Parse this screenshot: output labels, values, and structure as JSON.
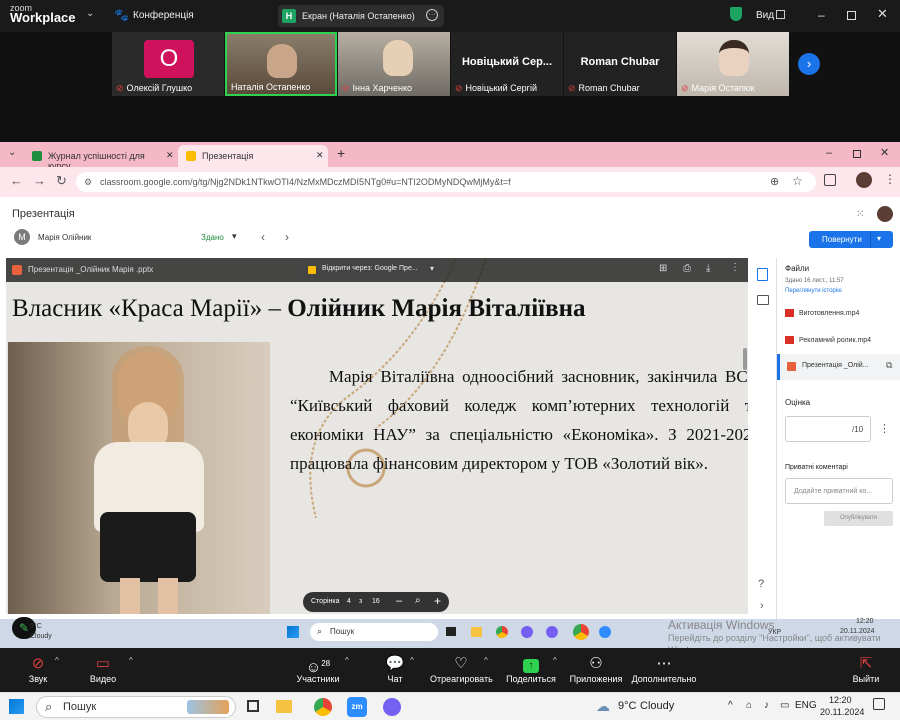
{
  "zoom": {
    "logo_line1": "zoom",
    "logo_line2": "Workplace",
    "conference_label": "Конференція",
    "screen_share_label": "Екран (Наталія Остапенко)",
    "screen_share_badge": "H",
    "view_label": "Вид",
    "participants": [
      {
        "name": "Олексій Глушко",
        "initial": "О",
        "type": "avatar",
        "color": "#d0115c"
      },
      {
        "name": "Наталія Остапенко",
        "type": "video"
      },
      {
        "name": "Інна Харченко",
        "type": "video"
      },
      {
        "name": "Новіцький Сергій",
        "display": "Новіцький Сер...",
        "type": "name"
      },
      {
        "name": "Roman Chubar",
        "display": "Roman Chubar",
        "type": "name"
      },
      {
        "name": "Марія Остапюк",
        "type": "video"
      }
    ],
    "bottom": {
      "audio": "Звук",
      "video": "Видео",
      "participants": "Участники",
      "participants_count": "28",
      "chat": "Чат",
      "react": "Отреагировать",
      "share": "Поделиться",
      "apps": "Приложения",
      "more": "Дополнительно",
      "leave": "Выйти"
    }
  },
  "browser": {
    "tabs": [
      {
        "title": "Журнал успішності для курсу"
      },
      {
        "title": "Презентація"
      }
    ],
    "url": "classroom.google.com/g/tg/Njg2NDk1NTkwOTI4/NzMxMDczMDI5NTg0#u=NTI2ODMyNDQwMjMy&t=f"
  },
  "classroom": {
    "title": "Презентація",
    "student_initial": "М",
    "student_name": "Марія Олійник",
    "status": "Здано",
    "return_button": "Повернути",
    "viewer": {
      "file_name": "Презентація _Олійник Марія .pptx",
      "open_with": "Відкрити через: Google Пре...",
      "page_label": "Сторінка",
      "page_current": "4",
      "page_of": "з",
      "page_total": "16"
    },
    "slide": {
      "title_plain": "Власник «Краса Марії» – ",
      "title_bold": "Олійник Марія Віталіївна",
      "body": "     Марія Віталіївна одноосібний засновник, закінчила ВСП “Київський фаховий коледж комп’ютерних технологій та економіки НАУ” за спеціальністю «Економіка». З 2021-2023 працювала фінансовим директором у ТОВ «Золотий вік»."
    },
    "panel": {
      "files_title": "Файли",
      "submitted": "Здано 16 лист., 11:57",
      "history_link": "Переглянути історію",
      "files": [
        "Виготовлення.mp4",
        "Рекламний ролик.mp4",
        "Презентація _Олій..."
      ],
      "grade_title": "Оцінка",
      "grade_out_of": "/10",
      "comments_title": "Приватні коментарі",
      "comment_placeholder": "Додайте приватний ко...",
      "publish_button": "Опублікувати"
    }
  },
  "inner_taskbar": {
    "weather_temp": "9°C",
    "weather_label": "Cloudy",
    "search": "Пошук",
    "lang": "УКР",
    "time": "12:20",
    "date": "20.11.2024",
    "activation_title": "Активація Windows",
    "activation_text": "Перейдіть до розділу \"Настройки\", щоб активувати Windows."
  },
  "taskbar": {
    "search": "Пошук",
    "weather_temp": "9°C",
    "weather_label": "Cloudy",
    "lang": "ENG",
    "time": "12:20",
    "date": "20.11.2024"
  }
}
